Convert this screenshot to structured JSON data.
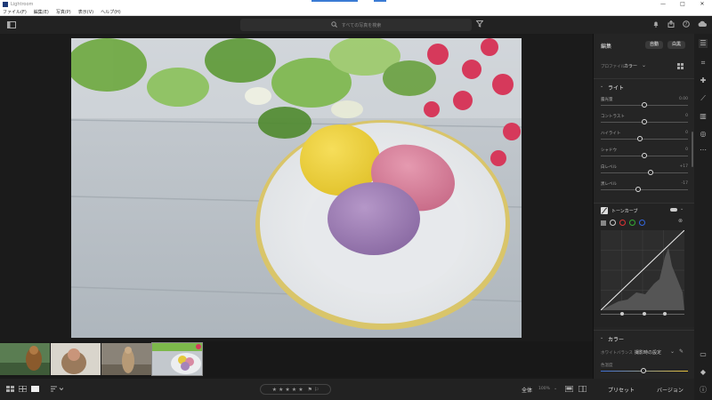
{
  "app": {
    "title": "Lightroom"
  },
  "window_controls": {
    "minimize": "—",
    "maximize": "□",
    "close": "✕"
  },
  "menu": [
    "ファイル(F)",
    "編集(E)",
    "写真(P)",
    "表示(V)",
    "ヘルプ(H)"
  ],
  "search": {
    "placeholder": "すべての写真を検索"
  },
  "filmstrip": {
    "thumbnails": [
      "monkey-1",
      "monkey-2",
      "meerkat",
      "sweets"
    ],
    "selected_index": 3
  },
  "bottombar": {
    "fit_label": "全体",
    "zoom": "100%",
    "presets_label": "プリセット",
    "versions_label": "バージョン"
  },
  "edit_panel": {
    "title": "編集",
    "auto_label": "自動",
    "bw_label": "白黒",
    "profile_label": "プロファイル",
    "profile_value": "カラー",
    "light_section": "ライト",
    "light_sliders": [
      {
        "label": "露光量",
        "value": "0.00",
        "pos": 0.5
      },
      {
        "label": "コントラスト",
        "value": "0",
        "pos": 0.5
      },
      {
        "label": "ハイライト",
        "value": "0",
        "pos": 0.45
      },
      {
        "label": "シャドウ",
        "value": "0",
        "pos": 0.5
      },
      {
        "label": "白レベル",
        "value": "+17",
        "pos": 0.58
      },
      {
        "label": "黒レベル",
        "value": "-17",
        "pos": 0.42
      }
    ],
    "tone_curve_label": "トーンカーブ",
    "color_section": "カラー",
    "white_balance_label": "ホワイトバランス",
    "white_balance_value": "撮影時の設定",
    "temp_label": "色温度"
  },
  "colors": {
    "accent": "#3b7bd4",
    "panel": "#252525",
    "bg": "#1b1b1b"
  }
}
